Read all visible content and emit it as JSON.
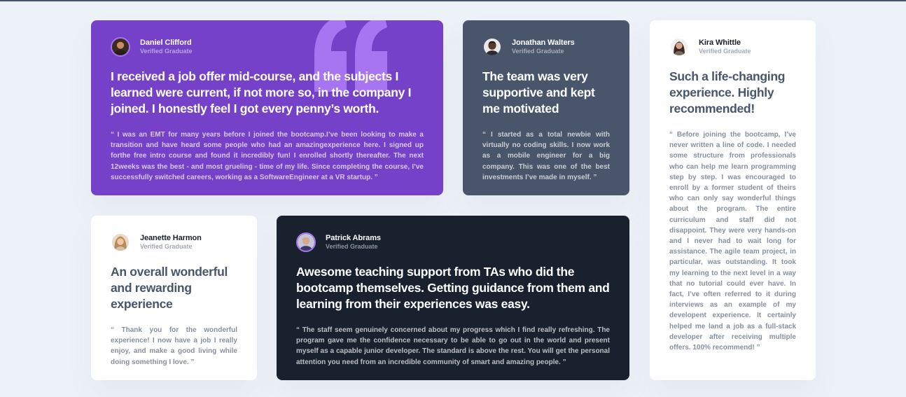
{
  "colors": {
    "background": "#edf1f8",
    "purple": "#7541c8",
    "gray_blue": "#48556a",
    "dark": "#19212e",
    "white": "#ffffff"
  },
  "testimonials": [
    {
      "name": "Daniel Clifford",
      "role": "Verified Graduate",
      "headline": "I received a job offer mid-course, and the subjects I learned were current, if not more so, in the company I joined. I honestly feel I got every penny’s worth.",
      "body": "“ I was an EMT for many years before I joined the bootcamp.I’ve been looking to make a transition and have heard some people who had an amazingexperience here. I signed up forthe free intro course and found it incredibly fun! I enrolled shortly thereafter. The next 12weeks was the best - and most grueling - time of my life. Since completing the course, I’ve successfully switched careers, working as a SoftwareEngineer at a VR startup. ”"
    },
    {
      "name": "Jonathan Walters",
      "role": "Verified Graduate",
      "headline": "The team was very supportive and kept me motivated",
      "body": "“ I started as a total newbie with virtually no coding skills. I now work as a mobile engineer for a big company. This was one of the best investments I’ve made in myself. ”"
    },
    {
      "name": "Kira Whittle",
      "role": "Verified Graduate",
      "headline": "Such a life-changing experience. Highly recommended!",
      "body": "“ Before joining the bootcamp, I’ve never written a line of code. I needed some structure from professionals who can help me learn programming step by step. I was encouraged to enroll by a former student of theirs who can only say wonderful things about the program. The entire curriculum and staff did not disappoint. They were very hands-on and I never had to wait long for assistance. The agile team project, in particular, was outstanding. It took my learning to the next level in a way that no tutorial could ever have. In fact, I’ve often referred to it during interviews as an example of my developent experience. It certainly helped me land a job as a full-stack developer after receiving multiple offers. 100% recommend! ”"
    },
    {
      "name": "Jeanette Harmon",
      "role": "Verified Graduate",
      "headline": "An overall wonderful and rewarding experience",
      "body": "“ Thank you for the wonderful experience! I now have a job I really enjoy, and make a good living while doing something I love. ”"
    },
    {
      "name": "Patrick Abrams",
      "role": "Verified Graduate",
      "headline": "Awesome teaching support from TAs who did the bootcamp themselves. Getting guidance from them and learning from their experiences was easy.",
      "body": "“ The staff seem genuinely concerned about my progress which I find really refreshing. The program gave me the confidence necessary to be able to go out in the world and present myself as a capable junior developer. The standard is above the rest. You will get the personal attention you need from an incredible community of smart and amazing people. ”"
    }
  ]
}
